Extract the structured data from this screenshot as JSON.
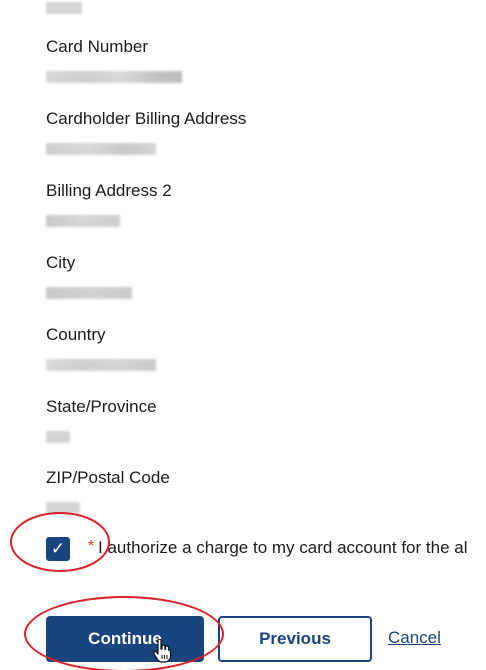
{
  "form": {
    "fields": [
      {
        "label": ""
      },
      {
        "label": "Card Number"
      },
      {
        "label": "Cardholder Billing Address"
      },
      {
        "label": "Billing Address 2"
      },
      {
        "label": "City"
      },
      {
        "label": "Country"
      },
      {
        "label": "State/Province"
      },
      {
        "label": "ZIP/Postal Code"
      }
    ],
    "consent": {
      "checked": true,
      "check_glyph": "✓",
      "required_marker": "*",
      "text": "I authorize a charge to my card account for the al"
    }
  },
  "actions": {
    "continue_label": "Continue",
    "previous_label": "Previous",
    "cancel_label": "Cancel"
  },
  "colors": {
    "primary": "#1a4480",
    "required": "#d54309",
    "annotation": "#d92128",
    "redacted_value": "#d0d0d0"
  },
  "icons": {
    "checkbox": "checkmark-icon",
    "cursor": "hand-pointer-icon"
  }
}
